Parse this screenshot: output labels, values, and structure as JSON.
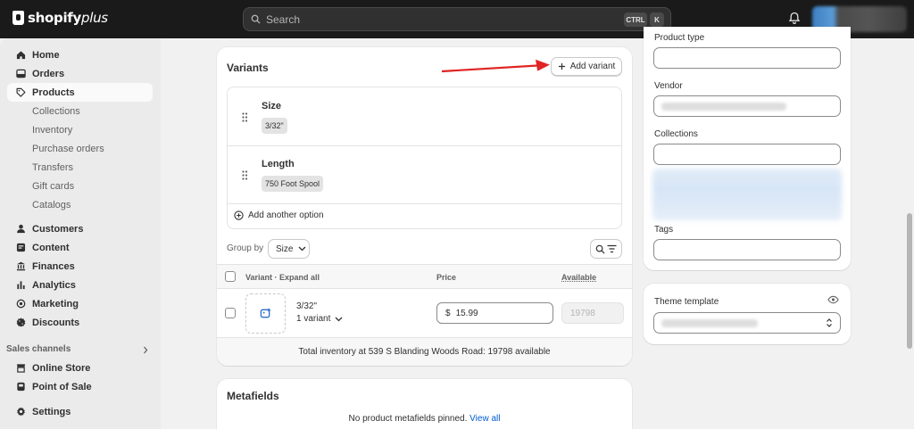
{
  "topbar": {
    "brand": "shopify",
    "brand_suffix": "plus",
    "search_placeholder": "Search",
    "shortcut_ctrl": "CTRL",
    "shortcut_k": "K"
  },
  "sidebar": {
    "main": [
      {
        "label": "Home",
        "icon": "home-icon"
      },
      {
        "label": "Orders",
        "icon": "orders-icon"
      },
      {
        "label": "Products",
        "icon": "tag-icon",
        "active": true
      }
    ],
    "product_subitems": [
      "Collections",
      "Inventory",
      "Purchase orders",
      "Transfers",
      "Gift cards",
      "Catalogs"
    ],
    "secondary": [
      {
        "label": "Customers",
        "icon": "person-icon"
      },
      {
        "label": "Content",
        "icon": "content-icon"
      },
      {
        "label": "Finances",
        "icon": "bank-icon"
      },
      {
        "label": "Analytics",
        "icon": "chart-icon"
      },
      {
        "label": "Marketing",
        "icon": "target-icon"
      },
      {
        "label": "Discounts",
        "icon": "discount-icon"
      }
    ],
    "sales_channels_label": "Sales channels",
    "channels": [
      {
        "label": "Online Store",
        "icon": "store-icon"
      },
      {
        "label": "Point of Sale",
        "icon": "pos-icon"
      }
    ],
    "settings": {
      "label": "Settings",
      "icon": "gear-icon"
    }
  },
  "variants": {
    "title": "Variants",
    "add_variant": "Add variant",
    "options": [
      {
        "name": "Size",
        "values": [
          "3/32\""
        ]
      },
      {
        "name": "Length",
        "values": [
          "750 Foot Spool"
        ]
      }
    ],
    "add_option": "Add another option",
    "group_by_label": "Group by",
    "group_by_value": "Size",
    "headers": {
      "variant": "Variant · Expand all",
      "price": "Price",
      "available": "Available"
    },
    "rows": [
      {
        "name": "3/32\"",
        "sub": "1 variant",
        "currency": "$",
        "price": "15.99",
        "available": "19798"
      }
    ],
    "total_inventory": "Total inventory at 539 S Blanding Woods Road: 19798 available"
  },
  "metafields": {
    "title": "Metafields",
    "empty_text": "No product metafields pinned.",
    "view_all": "View all"
  },
  "organization": {
    "product_type_label": "Product type",
    "vendor_label": "Vendor",
    "collections_label": "Collections",
    "tags_label": "Tags"
  },
  "theme": {
    "label": "Theme template"
  },
  "colors": {
    "topbar": "#1a1a1a",
    "link": "#005bd3",
    "annotation_arrow": "#e02424"
  }
}
